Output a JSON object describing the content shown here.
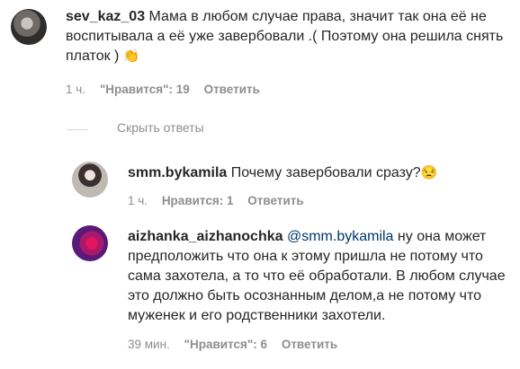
{
  "comments": [
    {
      "username": "sev_kaz_03",
      "text": "Мама в любом случае права, значит так она её не воспитывала а её уже завербовали .( Поэтому она решила снять платок )",
      "emoji": "👏",
      "time": "1 ч.",
      "likes": "\"Нравится\": 19",
      "reply": "Ответить"
    }
  ],
  "hide_replies": "Скрыть ответы",
  "replies": [
    {
      "username": "smm.bykamila",
      "text": "Почему завербовали сразу?",
      "emoji": "😒",
      "time": "1 ч.",
      "likes": "Нравится: 1",
      "reply": "Ответить"
    },
    {
      "username": "aizhanka_aizhanochka",
      "mention": "@smm.bykamila",
      "text": "ну она может предположить что она к этому пришла не потому что сама захотела, а то что её обработали. В любом случае это должно быть осознанным делом,а не потому что муженек и его родственники захотели.",
      "time": "39 мин.",
      "likes": "\"Нравится\": 6",
      "reply": "Ответить"
    }
  ],
  "icons": {
    "clap": "clapping-hands-emoji",
    "unamused": "unamused-face-emoji"
  }
}
